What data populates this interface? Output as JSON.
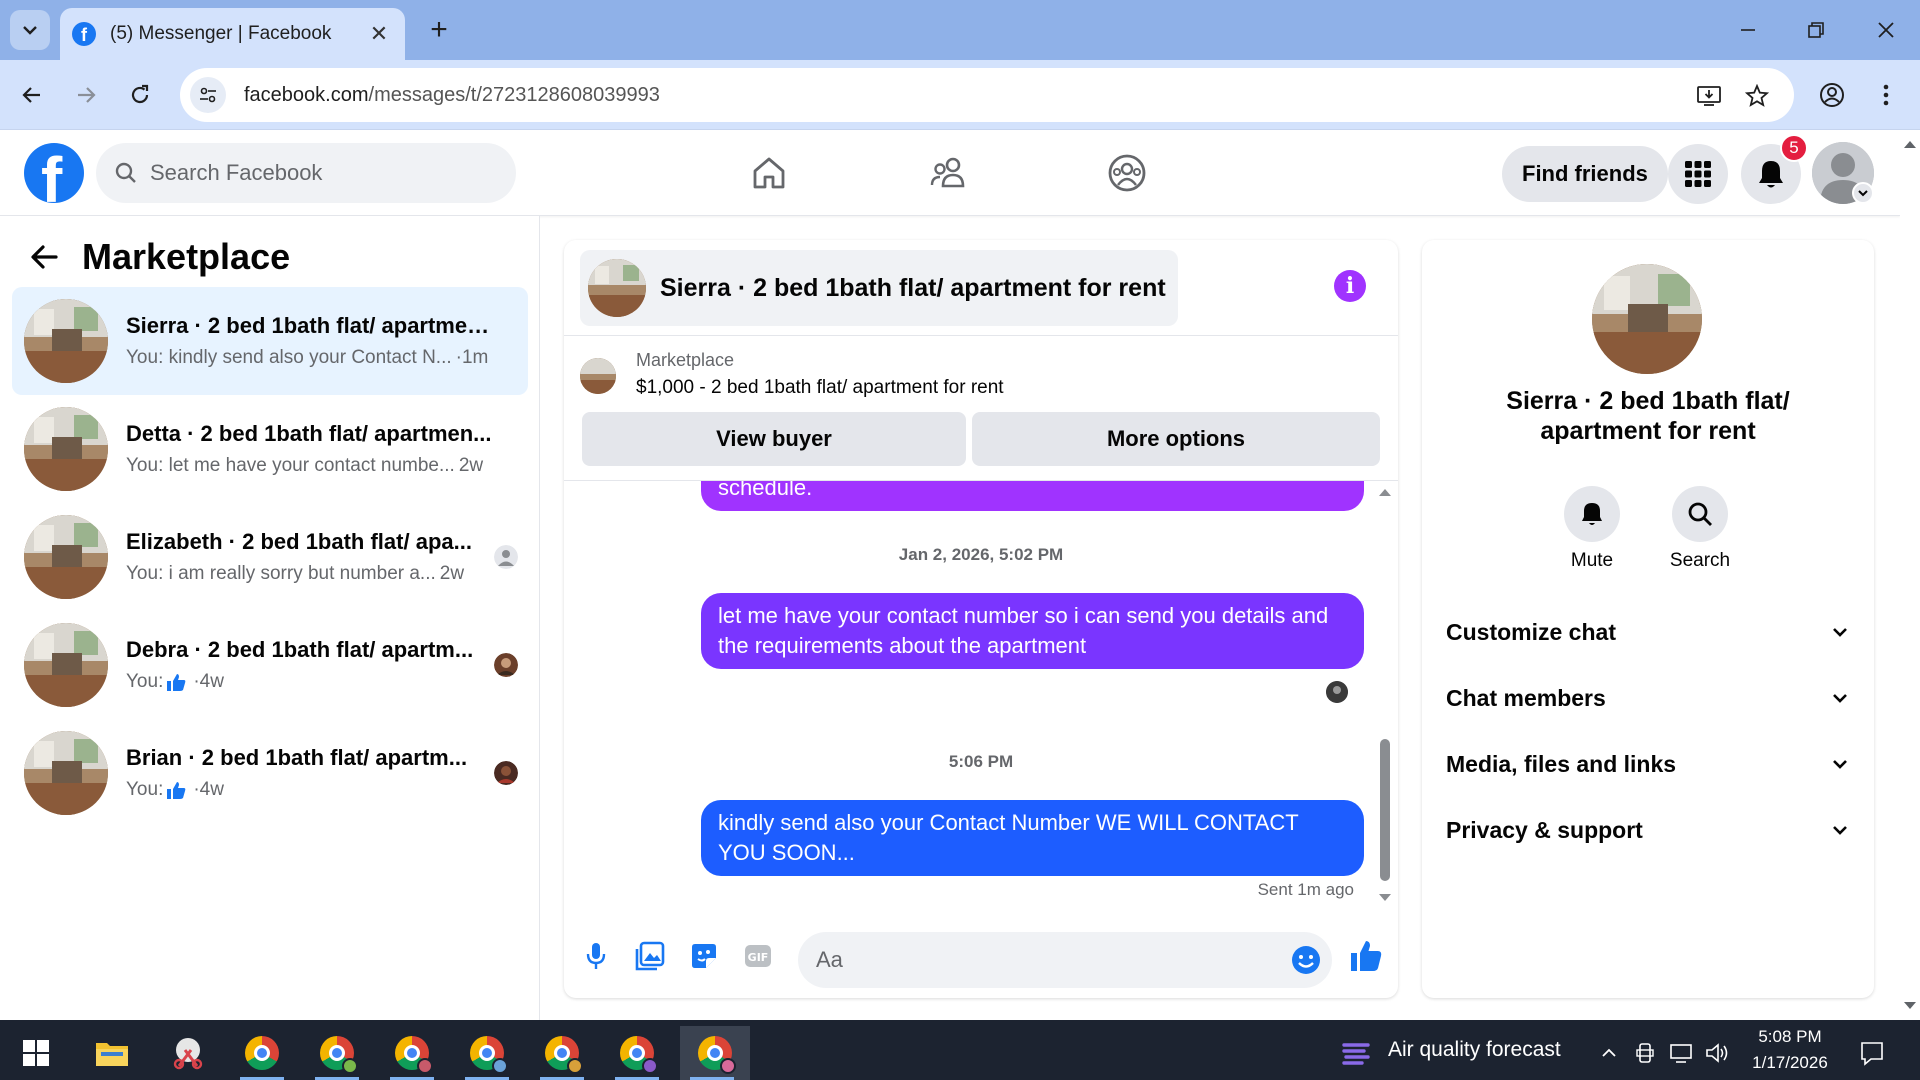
{
  "browser": {
    "tab_title": "(5) Messenger | Facebook",
    "url_domain": "facebook.com",
    "url_path": "/messages/t/2723128608039993"
  },
  "header": {
    "search_placeholder": "Search Facebook",
    "find_friends": "Find friends",
    "notification_count": "5"
  },
  "sidebar": {
    "title": "Marketplace",
    "conversations": [
      {
        "name": "Sierra · 2 bed 1bath flat/ apartmen...",
        "preview": "You: kindly send also your Contact N...",
        "time": "·1m",
        "active": true
      },
      {
        "name": "Detta · 2 bed 1bath flat/ apartmen...",
        "preview": "You: let me have your contact numbe...",
        "time": "2w"
      },
      {
        "name": "Elizabeth · 2 bed 1bath flat/ apa...",
        "preview": "You: i am really sorry but number a...",
        "time": "2w"
      },
      {
        "name": "Debra · 2 bed 1bath flat/ apartm...",
        "preview": "You: ",
        "time": "·4w"
      },
      {
        "name": "Brian · 2 bed 1bath flat/ apartm...",
        "preview": "You: ",
        "time": "·4w"
      }
    ]
  },
  "chat": {
    "title": "Sierra · 2 bed 1bath flat/ apartment for rent",
    "listing_label": "Marketplace",
    "listing_price": "$1,000 - 2 bed 1bath flat/ apartment for rent",
    "view_buyer": "View buyer",
    "more_options": "More options",
    "messages": [
      {
        "text": "schedule.",
        "color": "#a033ff"
      },
      {
        "timestamp": "Jan 2, 2026, 5:02 PM"
      },
      {
        "text": "let me have your contact number so i can send you details and the requirements about the apartment",
        "color": "#7a35ff"
      },
      {
        "timestamp": "5:06 PM"
      },
      {
        "text": "kindly send also your Contact Number WE WILL CONTACT YOU SOON...",
        "color": "#1d5dff"
      }
    ],
    "sent_status": "Sent 1m ago",
    "composer_placeholder": "Aa"
  },
  "details": {
    "title": "Sierra · 2 bed 1bath flat/ apartment for rent",
    "mute": "Mute",
    "search": "Search",
    "sections": [
      "Customize chat",
      "Chat members",
      "Media, files and links",
      "Privacy & support"
    ]
  },
  "taskbar": {
    "weather": "Air quality forecast",
    "time": "5:08 PM",
    "date": "1/17/2026"
  },
  "colors": {
    "facebook_blue": "#1877f2",
    "bubble_purple": "#a033ff",
    "bubble_violet": "#7a35ff",
    "bubble_blue": "#1d5dff",
    "active_conversation": "#e7f3ff"
  }
}
